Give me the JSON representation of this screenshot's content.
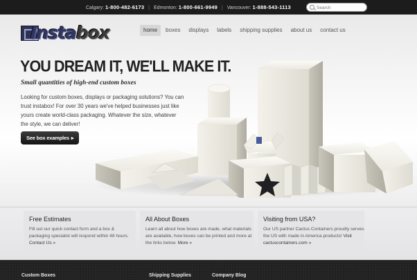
{
  "topbar": {
    "phones": [
      {
        "city": "Calgary:",
        "number": "1-800-482-6173"
      },
      {
        "city": "Edmonton:",
        "number": "1-800-661-9949"
      },
      {
        "city": "Vancouver:",
        "number": "1-888-543-1113"
      }
    ],
    "search": {
      "placeholder": "Search",
      "value": ""
    }
  },
  "header": {
    "logo": {
      "part1": "Insta",
      "part2": "box"
    },
    "nav": [
      {
        "label": "home",
        "active": true
      },
      {
        "label": "boxes",
        "active": false
      },
      {
        "label": "displays",
        "active": false
      },
      {
        "label": "labels",
        "active": false
      },
      {
        "label": "shipping supplies",
        "active": false
      },
      {
        "label": "about us",
        "active": false
      },
      {
        "label": "contact us",
        "active": false
      }
    ]
  },
  "hero": {
    "headline": "YOU DREAM IT, WE'LL MAKE IT.",
    "subhead": "Small quantities of high-end custom boxes",
    "intro": "Looking for custom boxes, displays or packaging solutions? You can trust instabox! For over 30 years we've helped businesses just like yours create world-class packaging. Whatever the size, whatever the style, we can deliver!",
    "cta": "See box examples"
  },
  "cards": [
    {
      "title": "Free Estimates",
      "body": "Fill out our quick contact form and a box & packaging specialist will respond within 48 hours.",
      "link": "Contact Us »"
    },
    {
      "title": "All About Boxes",
      "body": "Learn all about how boxes are made, what materials are available, how boxes can be printed and more at the links below.",
      "link": "More »"
    },
    {
      "title": "Visiting from USA?",
      "body": "Our US partner Cactus Containers proudly serves the US with made in America products!",
      "link": "Visit cactuscontainers.com »"
    }
  ],
  "footer": {
    "headings": [
      "Custom Boxes",
      "Shipping Supplies",
      "Company Blog"
    ]
  }
}
